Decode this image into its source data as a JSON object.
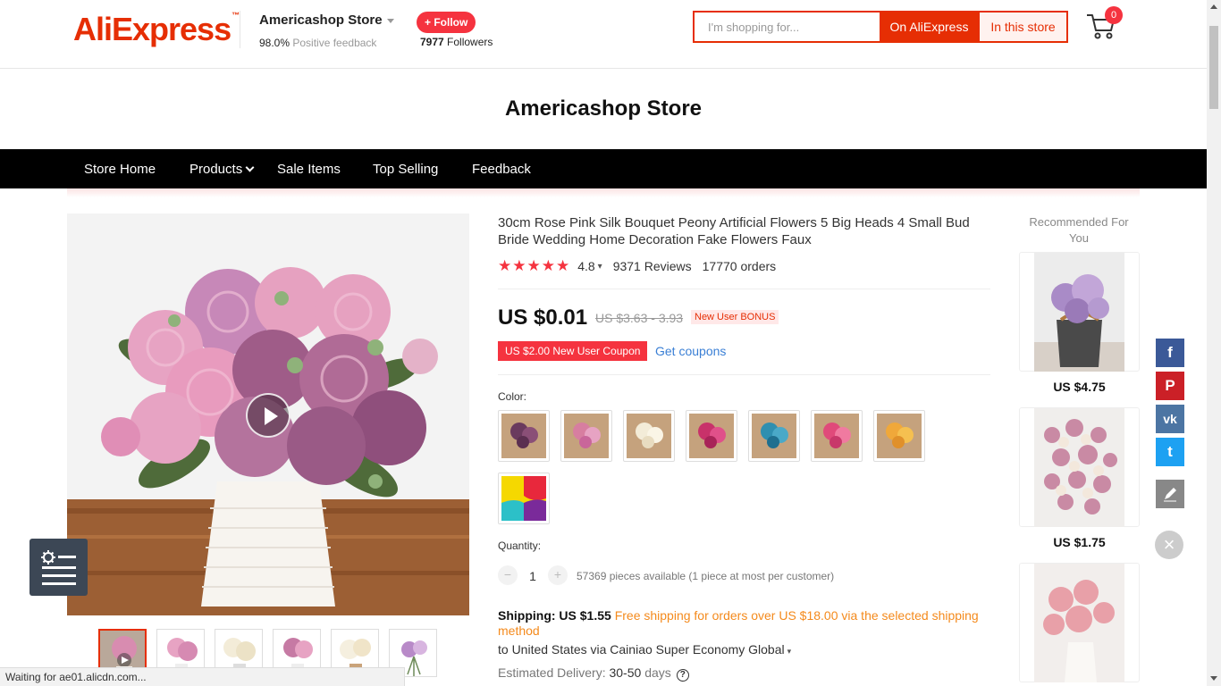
{
  "header": {
    "logo_text": "AliExpress",
    "logo_tm": "™",
    "store_name": "Americashop Store",
    "feedback_percent": "98.0%",
    "feedback_label": "Positive feedback",
    "follow_label": "+ Follow",
    "followers_count": "7977",
    "followers_label": "Followers",
    "search_placeholder": "I'm shopping for...",
    "search_all_label": "On AliExpress",
    "search_store_label": "In this store",
    "cart_count": "0"
  },
  "store_title": "Americashop Store",
  "nav": {
    "items": [
      "Store Home",
      "Products",
      "Sale Items",
      "Top Selling",
      "Feedback"
    ]
  },
  "product": {
    "title": "30cm Rose Pink Silk Bouquet Peony Artificial Flowers 5 Big Heads 4 Small Bud Bride Wedding Home Decoration Fake Flowers Faux",
    "rating": "4.8",
    "stars": "★★★★★",
    "reviews": "9371 Reviews",
    "orders": "17770 orders",
    "price": "US $0.01",
    "original_price": "US $3.63 - 3.93",
    "new_user_badge": "New User BONUS",
    "coupon": "US $2.00 New User Coupon",
    "get_coupons": "Get coupons",
    "color_label": "Color:",
    "quantity_label": "Quantity:",
    "quantity_minus": "−",
    "quantity_value": "1",
    "quantity_plus": "+",
    "quantity_available": "57369 pieces available (1 piece at most per customer)",
    "shipping_label": "Shipping: US $1.55",
    "shipping_free": "Free shipping for orders over US $18.00 via the selected shipping method",
    "ship_to": "to United States via Cainiao Super Economy Global",
    "est_label": "Estimated Delivery:",
    "est_value": "30-50",
    "est_unit": "days",
    "help_icon": "?"
  },
  "swatch_colors": [
    "#6a3a5e",
    "#d77ea0",
    "#f3ecd8",
    "#c8326a",
    "#2f8fb0",
    "#e04a7a",
    "#f0a83a"
  ],
  "recommended": {
    "title": "Recommended For You",
    "items": [
      {
        "price": "US $4.75",
        "color": "#a98bc7"
      },
      {
        "price": "US $1.75",
        "color": "#c98aa4"
      },
      {
        "price": "",
        "color": "#e8a0a8"
      }
    ]
  },
  "share": {
    "facebook": "f",
    "pinterest": "P",
    "vk": "vk",
    "twitter": "t",
    "close": "×"
  },
  "status_bar": "Waiting for ae01.alicdn.com..."
}
